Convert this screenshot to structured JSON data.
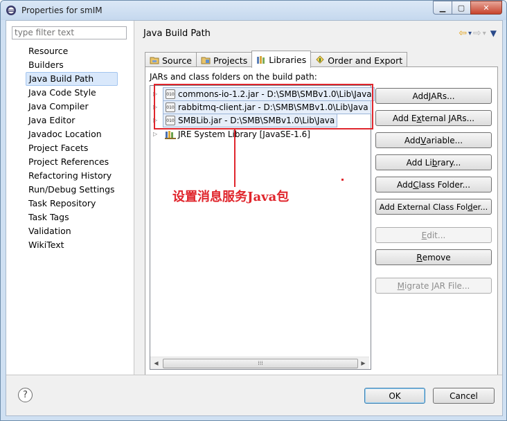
{
  "window": {
    "title": "Properties for smIM"
  },
  "left_pane": {
    "filter_placeholder": "type filter text",
    "items": [
      {
        "label": "Resource"
      },
      {
        "label": "Builders"
      },
      {
        "label": "Java Build Path"
      },
      {
        "label": "Java Code Style"
      },
      {
        "label": "Java Compiler"
      },
      {
        "label": "Java Editor"
      },
      {
        "label": "Javadoc Location"
      },
      {
        "label": "Project Facets"
      },
      {
        "label": "Project References"
      },
      {
        "label": "Refactoring History"
      },
      {
        "label": "Run/Debug Settings"
      },
      {
        "label": "Task Repository"
      },
      {
        "label": "Task Tags"
      },
      {
        "label": "Validation"
      },
      {
        "label": "WikiText"
      }
    ],
    "selected": "Java Build Path"
  },
  "page": {
    "title": "Java Build Path",
    "tabs": [
      {
        "label": "Source",
        "icon": "source-folder-icon"
      },
      {
        "label": "Projects",
        "icon": "projects-icon"
      },
      {
        "label": "Libraries",
        "icon": "libraries-icon",
        "active": true
      },
      {
        "label": "Order and Export",
        "icon": "order-export-icon"
      }
    ],
    "jars_label": "JARs and class folders on the build path:",
    "libraries": [
      {
        "label": "commons-io-1.2.jar - D:\\SMB\\SMBv1.0\\Lib\\Java",
        "icon": "jar-icon",
        "jar_text": "010"
      },
      {
        "label": "rabbitmq-client.jar - D:\\SMB\\SMBv1.0\\Lib\\Java",
        "icon": "jar-icon",
        "jar_text": "010"
      },
      {
        "label": "SMBLib.jar - D:\\SMB\\SMBv1.0\\Lib\\Java",
        "icon": "jar-icon",
        "jar_text": "010"
      },
      {
        "label": "JRE System Library [JavaSE-1.6]",
        "icon": "library-icon"
      }
    ],
    "annotation": "设置消息服务Java包",
    "buttons": {
      "add_jars": {
        "pre": "Add ",
        "u": "J",
        "post": "ARs..."
      },
      "add_external_jars": {
        "pre": "Add E",
        "u": "x",
        "post": "ternal JARs..."
      },
      "add_variable": {
        "pre": "Add ",
        "u": "V",
        "post": "ariable..."
      },
      "add_library": {
        "pre": "Add Li",
        "u": "b",
        "post": "rary..."
      },
      "add_class_folder": {
        "pre": "Add ",
        "u": "C",
        "post": "lass Folder..."
      },
      "add_external_class_folder": {
        "pre": "Add External Class Fol",
        "u": "d",
        "post": "er..."
      },
      "edit": {
        "pre": "",
        "u": "E",
        "post": "dit..."
      },
      "remove": {
        "pre": "",
        "u": "R",
        "post": "emove"
      },
      "migrate_jar": {
        "pre": "",
        "u": "M",
        "post": "igrate JAR File..."
      }
    }
  },
  "footer": {
    "ok": "OK",
    "cancel": "Cancel",
    "help_glyph": "?"
  },
  "colors": {
    "annotation": "#e0252c",
    "selection": "#d9e8fb"
  }
}
